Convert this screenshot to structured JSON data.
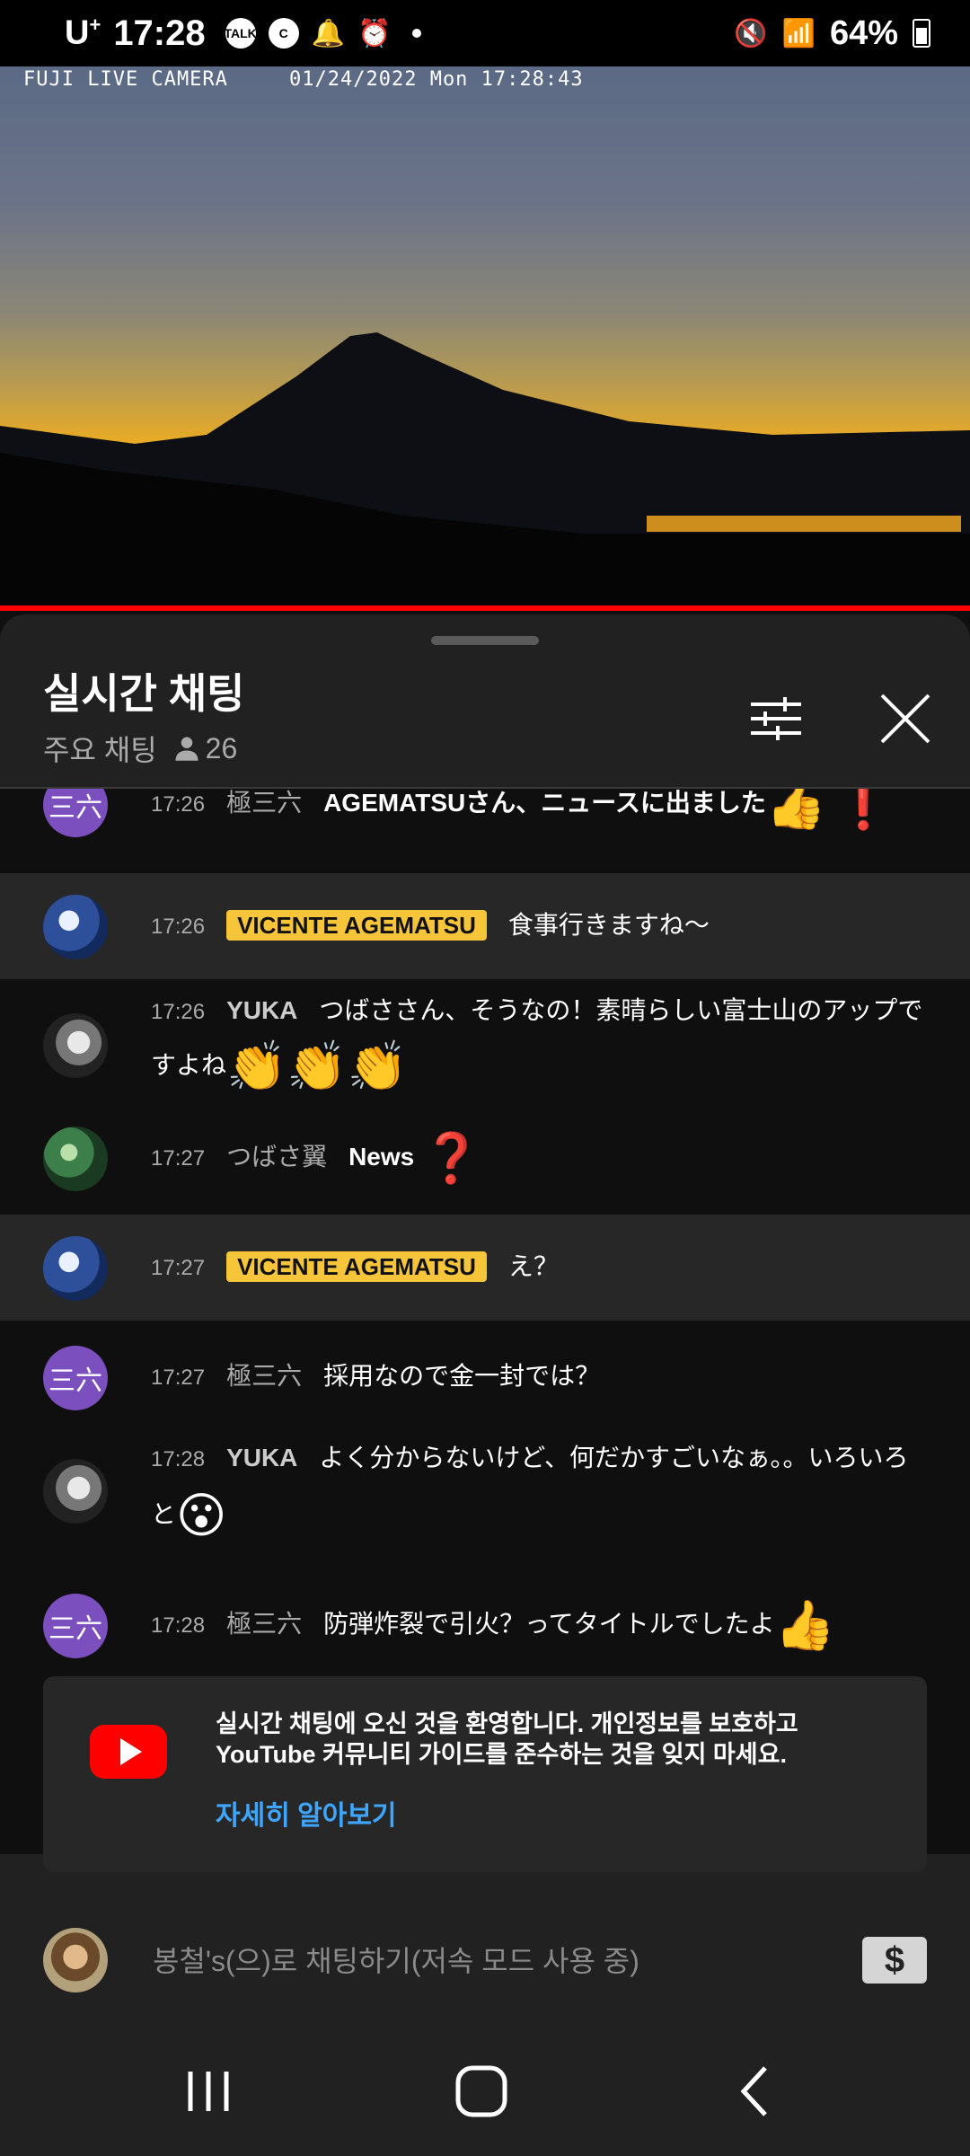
{
  "status_bar": {
    "carrier": "U",
    "carrier_sup": "+",
    "time": "17:28",
    "notif_icons": [
      "talk-icon",
      "c-icon",
      "bell-icon",
      "alarm-icon"
    ],
    "talk_label": "TALK",
    "c_label": "C",
    "battery": "64%",
    "battery_level": 0.64
  },
  "video": {
    "overlay_title": "FUJI LIVE CAMERA",
    "overlay_datetime": "01/24/2022 Mon 17:28:43"
  },
  "chat": {
    "title": "실시간 채팅",
    "mode": "주요 채팅",
    "viewer_count": "26",
    "messages": [
      {
        "time": "17:26",
        "author": "極三六",
        "text": "AGEMATSUさん、ニュースに出ました",
        "avatar": "三六"
      },
      {
        "time": "17:26",
        "author": "VICENTE AGEMATSU",
        "text": "食事行きますね〜"
      },
      {
        "time": "17:26",
        "author": "YUKA",
        "text": "つばささん、そうなの！素晴らしい富士山のアップで",
        "text2": "すよね"
      },
      {
        "time": "17:27",
        "author": "つばさ翼",
        "text": "News"
      },
      {
        "time": "17:27",
        "author": "VICENTE AGEMATSU",
        "text": "え？"
      },
      {
        "time": "17:27",
        "author": "極三六",
        "text": "採用なので金一封では？",
        "avatar": "三六"
      },
      {
        "time": "17:28",
        "author": "YUKA",
        "text": "よく分からないけど、何だかすごいなぁ。。いろいろ",
        "text2": "と"
      },
      {
        "time": "17:28",
        "author": "極三六",
        "text": "防弾炸裂で引火？ってタイトルでしたよ",
        "avatar": "三六"
      }
    ],
    "welcome_text": "실시간 채팅에 오신 것을 환영합니다. 개인정보를 보호하고 YouTube 커뮤니티 가이드를 준수하는 것을 잊지 마세요.",
    "learn_more": "자세히 알아보기",
    "input_placeholder": "봉철's(으)로 채팅하기(저속 모드 사용 중)",
    "superchat_symbol": "$"
  },
  "colors": {
    "badge": "#f7c53a",
    "link": "#3ea6ff",
    "progress": "#ff0000"
  }
}
